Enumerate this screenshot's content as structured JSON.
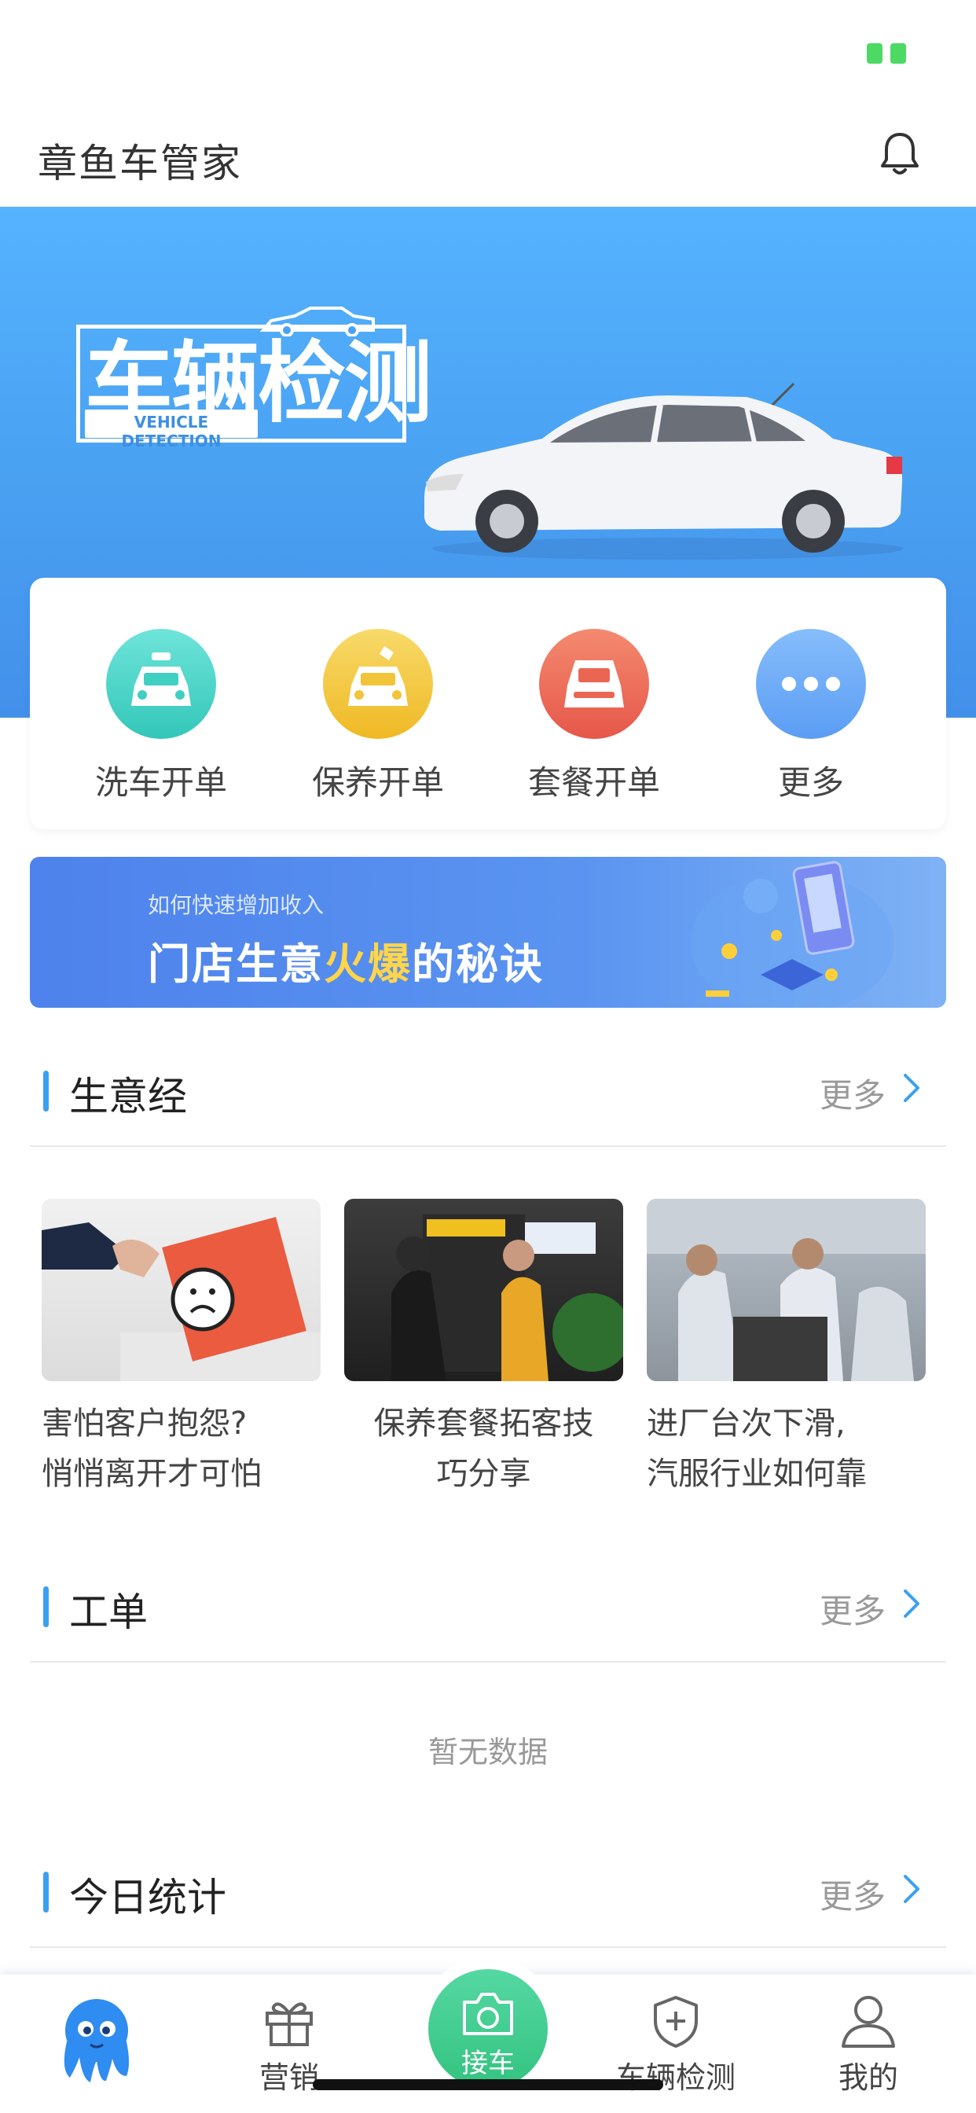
{
  "header": {
    "title": "章鱼车管家"
  },
  "hero": {
    "title": "车辆检测",
    "subtitle": "VEHICLE DETECTION"
  },
  "quick_actions": [
    {
      "label": "洗车开单",
      "icon": "car-wash-icon",
      "color": "#3fd6c8"
    },
    {
      "label": "保养开单",
      "icon": "car-maintenance-icon",
      "color": "#f3c83a"
    },
    {
      "label": "套餐开单",
      "icon": "car-package-icon",
      "color": "#ef7059"
    },
    {
      "label": "更多",
      "icon": "more-dots-icon",
      "color": "#66a9f8"
    }
  ],
  "promo": {
    "small_text": "如何快速增加收入",
    "big_text_part1": "门店生意",
    "big_text_highlight": "火爆",
    "big_text_part2": "的秘诀"
  },
  "sections": {
    "business": {
      "title": "生意经",
      "more": "更多"
    },
    "orders": {
      "title": "工单",
      "more": "更多",
      "empty_text": "暂无数据"
    },
    "today": {
      "title": "今日统计",
      "more": "更多"
    }
  },
  "articles": [
    {
      "title_line1": "害怕客户抱怨?",
      "title_line2": "悄悄离开才可怕"
    },
    {
      "title_line1": "保养套餐拓客技",
      "title_line2": "巧分享"
    },
    {
      "title_line1": "进厂台次下滑,",
      "title_line2": "汽服行业如何靠"
    }
  ],
  "tabbar": {
    "home_icon": "octopus-icon",
    "marketing": "营销",
    "pickup": "接车",
    "inspection": "车辆检测",
    "mine": "我的"
  },
  "colors": {
    "accent": "#3aa0f2",
    "hero_blue": "#4aa2f2",
    "center_green": "#3cc98a",
    "highlight": "#ffd54a"
  }
}
